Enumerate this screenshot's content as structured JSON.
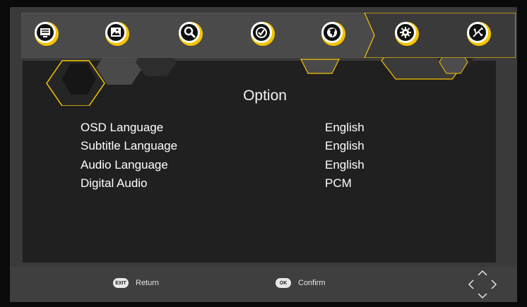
{
  "top_menu": {
    "items": [
      {
        "name": "picture-menu",
        "icon": "screen-icon"
      },
      {
        "name": "image-menu",
        "icon": "image-icon"
      },
      {
        "name": "search-menu",
        "icon": "search-icon"
      },
      {
        "name": "time-menu",
        "icon": "clock-icon"
      },
      {
        "name": "globe-menu",
        "icon": "globe-icon"
      },
      {
        "name": "settings-menu",
        "icon": "gear-icon",
        "selected": true
      },
      {
        "name": "usb-menu",
        "icon": "usb-icon"
      }
    ]
  },
  "page": {
    "title": "Option",
    "options": [
      {
        "label": "OSD Language",
        "value": "English"
      },
      {
        "label": "Subtitle Language",
        "value": "English"
      },
      {
        "label": "Audio Language",
        "value": "English"
      },
      {
        "label": "Digital Audio",
        "value": "PCM"
      }
    ]
  },
  "footer": {
    "exit_key": "EXIT",
    "return_label": "Return",
    "ok_key": "OK",
    "confirm_label": "Confirm"
  },
  "colors": {
    "accent": "#f5c400",
    "frame": "#3a3a3a",
    "background": "#202020"
  }
}
